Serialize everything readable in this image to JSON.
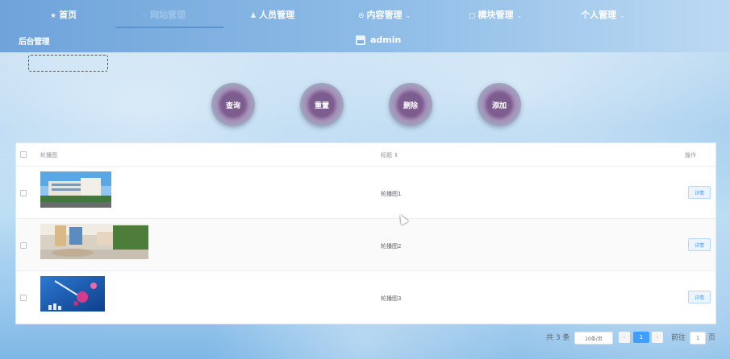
{
  "nav": {
    "items": [
      {
        "icon": "★",
        "label": "首页",
        "arrow": ""
      },
      {
        "icon": "☆",
        "label": "网站管理",
        "arrow": ""
      },
      {
        "icon": "♟",
        "label": "人员管理",
        "arrow": ""
      },
      {
        "icon": "⊙",
        "label": "内容管理",
        "arrow": "⌄"
      },
      {
        "icon": "▢",
        "label": "模块管理",
        "arrow": "⌄"
      },
      {
        "icon": "",
        "label": "个人管理",
        "arrow": "⌄"
      }
    ],
    "active_index": 1
  },
  "header": {
    "system_title": "后台管理",
    "user": "admin"
  },
  "actions": {
    "query": "查询",
    "reset": "重置",
    "delete": "删除",
    "add": "添加"
  },
  "table": {
    "columns": {
      "image": "轮播图",
      "title": "标题 ⇕",
      "ops": "操作"
    },
    "rows": [
      {
        "title": "轮播图1",
        "detail": "详情"
      },
      {
        "title": "轮播图2",
        "detail": "详情"
      },
      {
        "title": "轮播图3",
        "detail": "详情"
      }
    ]
  },
  "pagination": {
    "total": "共 3 条",
    "page_size": "10条/页",
    "prev": "‹",
    "current": "1",
    "next": "›",
    "goto": "前往",
    "goto_value": "1",
    "page_suffix": "页"
  },
  "colors": {
    "accent": "#409eff",
    "nav_start": "#6fa3da",
    "nav_end": "#bcd9f3"
  }
}
